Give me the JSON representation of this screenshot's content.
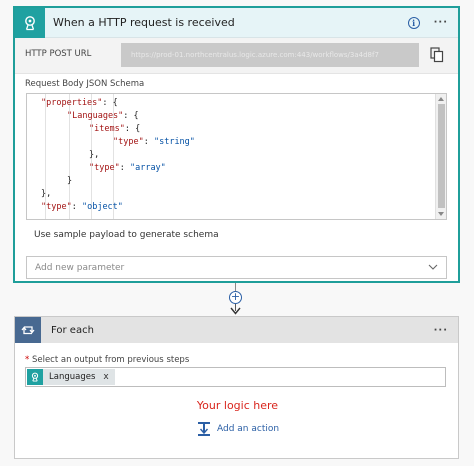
{
  "trigger": {
    "title": "When a HTTP request is received",
    "url_label": "HTTP POST URL",
    "url_value": "https://prod-01.northcentralus.logic.azure.com:443/workflows/3a4d8f7",
    "schema_label": "Request Body JSON Schema",
    "code_lines": [
      [
        {
          "t": "\"properties\"",
          "c": "key"
        },
        {
          "t": ": {",
          "c": "punct"
        }
      ],
      [
        {
          "t": "\"Languages\"",
          "c": "key"
        },
        {
          "t": ": {",
          "c": "punct"
        }
      ],
      [
        {
          "t": "\"items\"",
          "c": "key"
        },
        {
          "t": ": {",
          "c": "punct"
        }
      ],
      [
        {
          "t": "\"type\"",
          "c": "key"
        },
        {
          "t": ": ",
          "c": "punct"
        },
        {
          "t": "\"string\"",
          "c": "str"
        }
      ],
      [
        {
          "t": "},",
          "c": "punct"
        }
      ],
      [
        {
          "t": "\"type\"",
          "c": "key"
        },
        {
          "t": ": ",
          "c": "punct"
        },
        {
          "t": "\"array\"",
          "c": "str"
        }
      ],
      [
        {
          "t": "}",
          "c": "punct"
        }
      ],
      [
        {
          "t": "},",
          "c": "punct"
        }
      ],
      [
        {
          "t": "\"type\"",
          "c": "key"
        },
        {
          "t": ": ",
          "c": "punct"
        },
        {
          "t": "\"object\"",
          "c": "str"
        }
      ]
    ],
    "sample_link": "Use sample payload to generate schema",
    "add_param_placeholder": "Add new parameter"
  },
  "foreach": {
    "title": "For each",
    "select_required_mark": "*",
    "select_label": "Select an output from previous steps",
    "token_label": "Languages",
    "token_remove": "x",
    "logic_text": "Your logic here",
    "add_action_label": "Add an action"
  },
  "more_menu": "···",
  "info_glyph": "i",
  "add_glyph": "+",
  "icons": {
    "trigger": "http-request-icon",
    "copy": "copy-icon",
    "info": "info-icon",
    "foreach": "loop-icon",
    "add_action": "add-action-icon"
  },
  "colors": {
    "accent_teal": "#1fa1a1",
    "card_border": "#1f9e9a",
    "foreach_blue": "#486991",
    "link_blue": "#2b5fa5",
    "logic_red": "#d9251d"
  }
}
